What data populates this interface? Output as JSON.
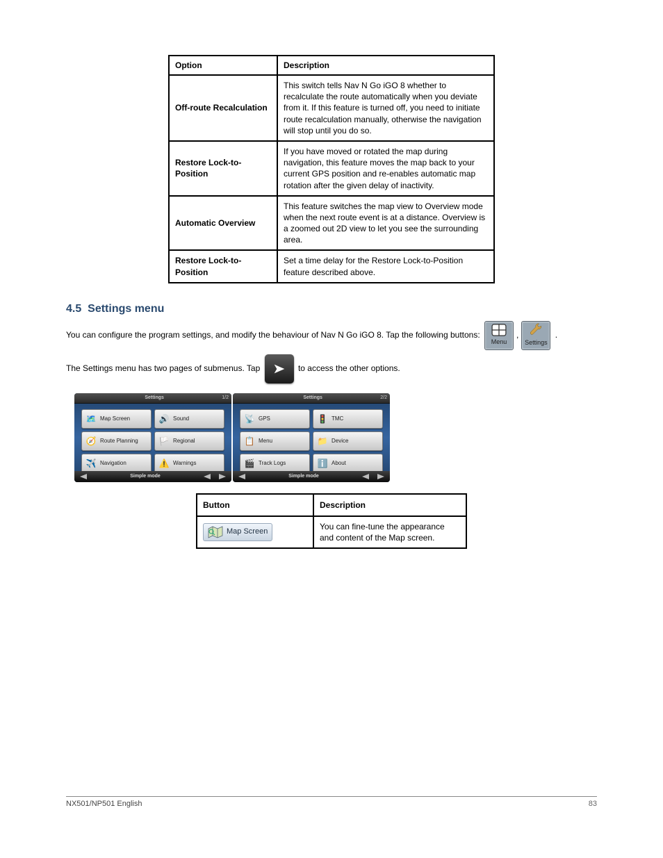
{
  "table1": {
    "headers": [
      "Option",
      "Description"
    ],
    "rows": [
      {
        "opt": "Off-route Recalculation",
        "desc": "This switch tells Nav N Go iGO 8 whether to recalculate the route automatically when you deviate from it. If this feature is turned off, you need to initiate route recalculation manually, otherwise the navigation will stop until you do so."
      },
      {
        "opt": "Restore Lock-to-Position",
        "desc": "If you have moved or rotated the map during navigation, this feature moves the map back to your current GPS position and re-enables automatic map rotation after the given delay of inactivity."
      },
      {
        "opt": "Automatic Overview",
        "desc": "This feature switches the map view to Overview mode when the next route event is at a distance. Overview is a zoomed out 2D view to let you see the surrounding area."
      },
      {
        "opt": "Restore Lock-to-Position",
        "desc": "Set a time delay for the Restore Lock-to-Position feature described above."
      }
    ]
  },
  "section": {
    "number": "4.5",
    "title": "Settings menu",
    "para1_pre": "You can configure the program settings, and modify the behaviour of Nav N Go iGO 8. Tap the following buttons:",
    "para1_post": ".",
    "para2_pre": "The Settings menu has two pages of submenus. Tap ",
    "para2_post": " to access the other options.",
    "menu_btn": "Menu",
    "settings_btn": "Settings"
  },
  "device1": {
    "title": "Settings",
    "page": "1/2",
    "mode": "Simple mode",
    "items": [
      {
        "icon": "🗺️",
        "label": "Map Screen"
      },
      {
        "icon": "🔊",
        "label": "Sound"
      },
      {
        "icon": "🧭",
        "label": "Route Planning"
      },
      {
        "icon": "🏳️",
        "label": "Regional"
      },
      {
        "icon": "✈️",
        "label": "Navigation"
      },
      {
        "icon": "⚠️",
        "label": "Warnings"
      }
    ]
  },
  "device2": {
    "title": "Settings",
    "page": "2/2",
    "mode": "Simple mode",
    "items": [
      {
        "icon": "📡",
        "label": "GPS"
      },
      {
        "icon": "🚦",
        "label": "TMC"
      },
      {
        "icon": "📋",
        "label": "Menu"
      },
      {
        "icon": "📁",
        "label": "Device"
      },
      {
        "icon": "🎬",
        "label": "Track Logs"
      },
      {
        "icon": "ℹ️",
        "label": "About"
      }
    ]
  },
  "table2": {
    "headers": [
      "Button",
      "Description"
    ],
    "row": {
      "btn": "Map Screen",
      "desc": "You can fine-tune the appearance and content of the Map screen."
    }
  },
  "footer": {
    "left": "NX501/NP501 English",
    "right": "83"
  }
}
